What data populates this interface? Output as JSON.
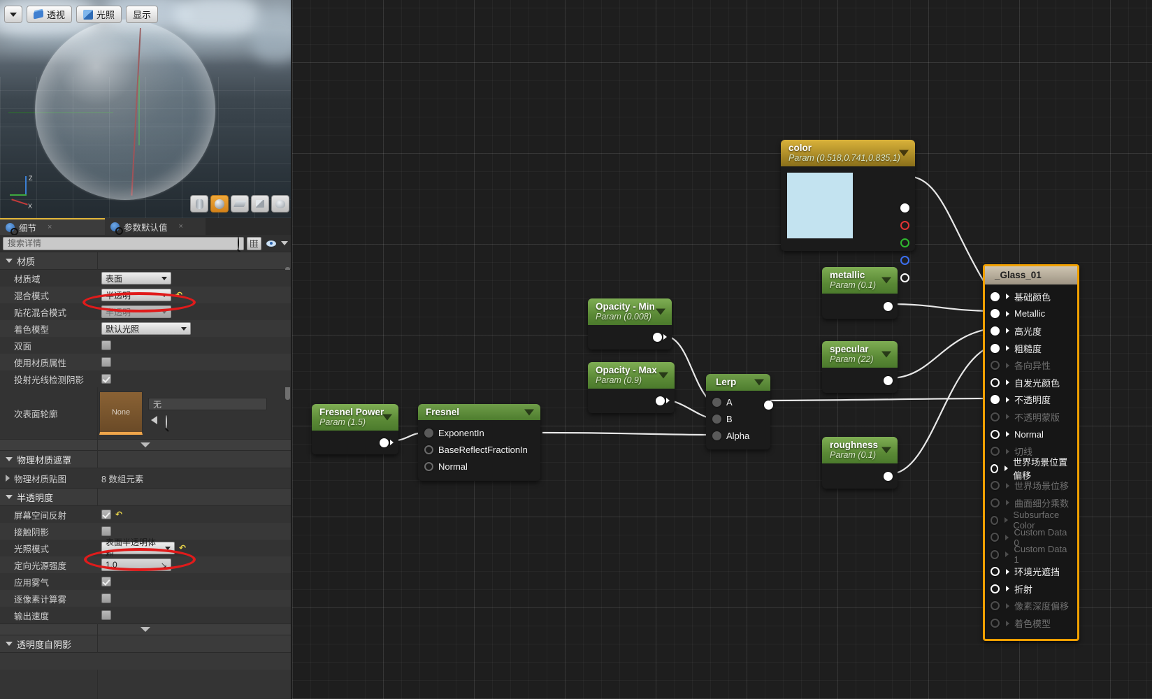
{
  "viewport": {
    "toolbar": {
      "dropdown_icon": "chevron-down-icon",
      "perspective_label": "透视",
      "lighting_label": "光照",
      "show_label": "显示"
    },
    "gizmo": {
      "z": "Z",
      "x": "X"
    },
    "shape_buttons": [
      "cylinder",
      "sphere",
      "plane",
      "cube",
      "teapot"
    ],
    "active_shape_index": 1
  },
  "tabs": [
    {
      "label": "细节",
      "icon": "info-icon",
      "close": "×",
      "active": true
    },
    {
      "label": "参数默认值",
      "icon": "info-icon",
      "close": "×",
      "active": false
    }
  ],
  "search": {
    "placeholder": "搜索详情",
    "value": "",
    "magnifier_icon": "search-icon",
    "grid_icon": "grid-view-icon",
    "eye_icon": "eye-icon",
    "chevron_icon": "chevron-down-icon"
  },
  "sections": [
    {
      "title": "材质",
      "rows": [
        {
          "label": "材质域",
          "type": "combo",
          "value": "表面",
          "width": "w100"
        },
        {
          "label": "混合模式",
          "type": "combo",
          "value": "半透明",
          "width": "w100",
          "reset": true,
          "highlight": true
        },
        {
          "label": "贴花混合模式",
          "type": "combo",
          "value": "半透明",
          "width": "w100",
          "disabled": true
        },
        {
          "label": "着色模型",
          "type": "combo",
          "value": "默认光照",
          "width": "w128"
        },
        {
          "label": "双面",
          "type": "check",
          "checked": false
        },
        {
          "label": "使用材质属性",
          "type": "check",
          "checked": false
        },
        {
          "label": "投射光线检测阴影",
          "type": "check",
          "checked": true
        },
        {
          "label": "次表面轮廓",
          "type": "asset",
          "thumb_label": "None",
          "asset_value": "无"
        }
      ]
    },
    {
      "title": "物理材质遮罩",
      "rows": [
        {
          "label": "物理材质贴图",
          "type": "text",
          "value": "8 数组元素",
          "expandable": true
        }
      ]
    },
    {
      "title": "半透明度",
      "rows": [
        {
          "label": "屏幕空间反射",
          "type": "check",
          "checked": true,
          "reset": true
        },
        {
          "label": "接触阴影",
          "type": "check",
          "checked": false
        },
        {
          "label": "光照模式",
          "type": "combo",
          "value": "表面半透明体积",
          "width": "w105",
          "reset": true,
          "highlight": true
        },
        {
          "label": "定向光源强度",
          "type": "num",
          "value": "1.0"
        },
        {
          "label": "应用雾气",
          "type": "check",
          "checked": true
        },
        {
          "label": "逐像素计算雾",
          "type": "check",
          "checked": false
        },
        {
          "label": "输出速度",
          "type": "check",
          "checked": false
        }
      ]
    },
    {
      "title": "透明度自阴影",
      "rows": []
    }
  ],
  "graph": {
    "nodes": {
      "color": {
        "title": "color",
        "subtitle": "Param (0.518,0.741,0.835,1)",
        "swatch_color": "#c3e3f0",
        "pins": [
          "RGBA",
          "R",
          "G",
          "B",
          "A"
        ]
      },
      "metallic": {
        "title": "metallic",
        "subtitle": "Param (0.1)"
      },
      "specular": {
        "title": "specular",
        "subtitle": "Param (22)"
      },
      "roughness": {
        "title": "roughness",
        "subtitle": "Param (0.1)"
      },
      "opacity_min": {
        "title": "Opacity - Min",
        "subtitle": "Param (0.008)"
      },
      "opacity_max": {
        "title": "Opacity - Max",
        "subtitle": "Param (0.9)"
      },
      "fresnel_power": {
        "title": "Fresnel Power",
        "subtitle": "Param (1.5)"
      },
      "fresnel": {
        "title": "Fresnel",
        "inputs": [
          "ExponentIn",
          "BaseReflectFractionIn",
          "Normal"
        ]
      },
      "lerp": {
        "title": "Lerp",
        "inputs": [
          "A",
          "B",
          "Alpha"
        ]
      },
      "glass": {
        "title": "_Glass_01",
        "inputs": [
          {
            "label": "基础颜色",
            "enabled": true,
            "connected": true
          },
          {
            "label": "Metallic",
            "enabled": true,
            "connected": true
          },
          {
            "label": "高光度",
            "enabled": true,
            "connected": true
          },
          {
            "label": "粗糙度",
            "enabled": true,
            "connected": true
          },
          {
            "label": "各向异性",
            "enabled": false,
            "connected": false
          },
          {
            "label": "自发光颜色",
            "enabled": true,
            "connected": false
          },
          {
            "label": "不透明度",
            "enabled": true,
            "connected": true
          },
          {
            "label": "不透明蒙版",
            "enabled": false,
            "connected": false
          },
          {
            "label": "Normal",
            "enabled": true,
            "connected": false
          },
          {
            "label": "切线",
            "enabled": false,
            "connected": false
          },
          {
            "label": "世界场景位置偏移",
            "enabled": true,
            "connected": false
          },
          {
            "label": "世界场景位移",
            "enabled": false,
            "connected": false
          },
          {
            "label": "曲面细分乘数",
            "enabled": false,
            "connected": false
          },
          {
            "label": "Subsurface Color",
            "enabled": false,
            "connected": false
          },
          {
            "label": "Custom Data 0",
            "enabled": false,
            "connected": false
          },
          {
            "label": "Custom Data 1",
            "enabled": false,
            "connected": false
          },
          {
            "label": "环境光遮挡",
            "enabled": true,
            "connected": false
          },
          {
            "label": "折射",
            "enabled": true,
            "connected": false
          },
          {
            "label": "像素深度偏移",
            "enabled": false,
            "connected": false
          },
          {
            "label": "着色模型",
            "enabled": false,
            "connected": false
          }
        ]
      }
    }
  },
  "colors": {
    "accent_orange": "#f0a000",
    "annotation_red": "#e01b1b",
    "param_green": "#5b8a36",
    "param_gold": "#8a6f1a",
    "swatch_blue": "#c3e3f0"
  }
}
